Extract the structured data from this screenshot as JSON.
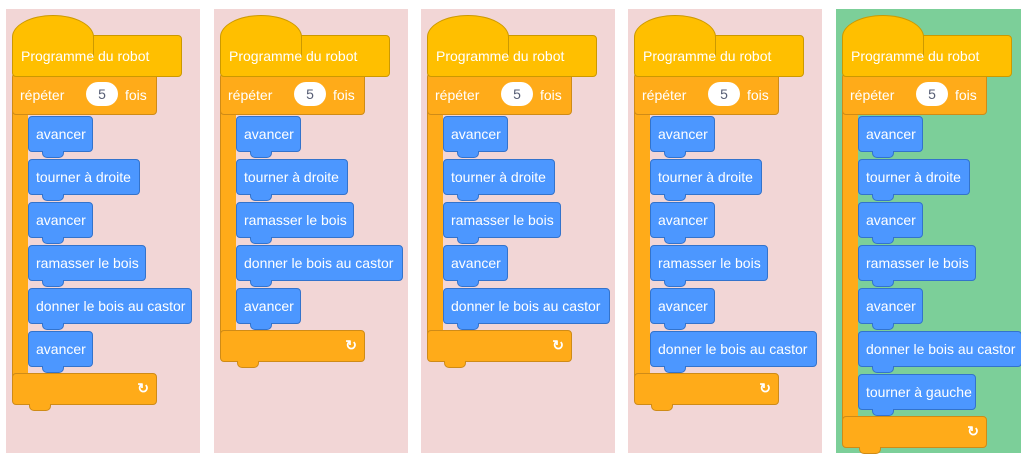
{
  "colors": {
    "panel_incorrect": "#f2d6d6",
    "panel_correct": "#7ccf99",
    "event_block": "#ffbf00",
    "control_block": "#ffab19",
    "motion_block": "#4c97ff"
  },
  "programs": [
    {
      "status": "incorrect",
      "hat_label": "Programme du robot",
      "loop": {
        "prefix": "répéter",
        "count": "5",
        "suffix": "fois",
        "end_icon": "loop-arrow-icon"
      },
      "commands": [
        "avancer",
        "tourner à droite",
        "avancer",
        "ramasser le bois",
        "donner le bois au castor",
        "avancer"
      ]
    },
    {
      "status": "incorrect",
      "hat_label": "Programme du robot",
      "loop": {
        "prefix": "répéter",
        "count": "5",
        "suffix": "fois",
        "end_icon": "loop-arrow-icon"
      },
      "commands": [
        "avancer",
        "tourner à droite",
        "ramasser le bois",
        "donner le bois au castor",
        "avancer"
      ]
    },
    {
      "status": "incorrect",
      "hat_label": "Programme du robot",
      "loop": {
        "prefix": "répéter",
        "count": "5",
        "suffix": "fois",
        "end_icon": "loop-arrow-icon"
      },
      "commands": [
        "avancer",
        "tourner à droite",
        "ramasser le bois",
        "avancer",
        "donner le bois au castor"
      ]
    },
    {
      "status": "incorrect",
      "hat_label": "Programme du robot",
      "loop": {
        "prefix": "répéter",
        "count": "5",
        "suffix": "fois",
        "end_icon": "loop-arrow-icon"
      },
      "commands": [
        "avancer",
        "tourner à droite",
        "avancer",
        "ramasser le bois",
        "avancer",
        "donner le bois au castor"
      ]
    },
    {
      "status": "correct",
      "hat_label": "Programme du robot",
      "loop": {
        "prefix": "répéter",
        "count": "5",
        "suffix": "fois",
        "end_icon": "loop-arrow-icon"
      },
      "commands": [
        "avancer",
        "tourner à droite",
        "avancer",
        "ramasser le bois",
        "avancer",
        "donner le bois au castor",
        "tourner à gauche"
      ]
    }
  ]
}
